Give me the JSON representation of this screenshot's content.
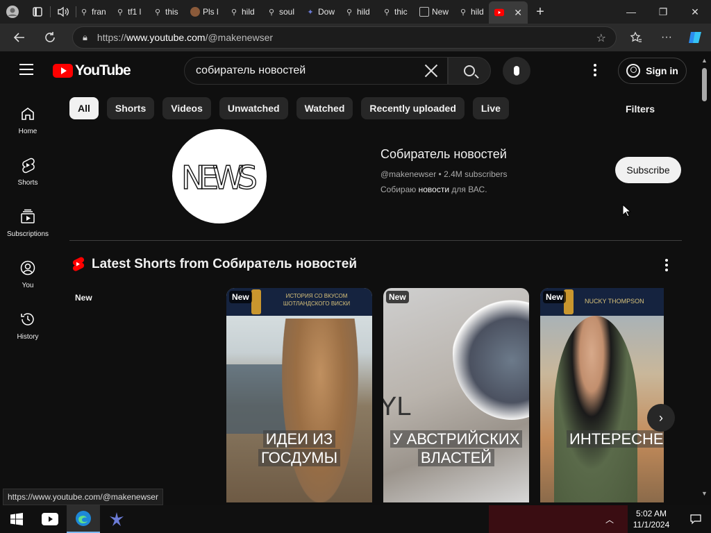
{
  "browser": {
    "tabs": [
      {
        "label": "fran",
        "icon": "search-icon"
      },
      {
        "label": "tf1 l",
        "icon": "search-icon"
      },
      {
        "label": "this",
        "icon": "search-icon"
      },
      {
        "label": "Pls l",
        "icon": "avatar-icon"
      },
      {
        "label": "hild",
        "icon": "search-icon"
      },
      {
        "label": "soul",
        "icon": "search-icon"
      },
      {
        "label": "Dow",
        "icon": "dove-icon"
      },
      {
        "label": "hild",
        "icon": "search-icon"
      },
      {
        "label": "thic",
        "icon": "search-icon"
      },
      {
        "label": "New",
        "icon": "page-icon"
      },
      {
        "label": "hild",
        "icon": "search-icon"
      }
    ],
    "url_prefix": "https://",
    "url_host": "www.youtube.com",
    "url_path": "/@makenewser",
    "status_url": "https://www.youtube.com/@makenewser"
  },
  "youtube": {
    "logo_text": "YouTube",
    "search_value": "собиратель новостей",
    "signin_label": "Sign in",
    "sidebar": [
      {
        "label": "Home",
        "icon": "home-icon"
      },
      {
        "label": "Shorts",
        "icon": "shorts-icon"
      },
      {
        "label": "Subscriptions",
        "icon": "subscriptions-icon"
      },
      {
        "label": "You",
        "icon": "you-icon"
      },
      {
        "label": "History",
        "icon": "history-icon"
      }
    ],
    "chips": [
      "All",
      "Shorts",
      "Videos",
      "Unwatched",
      "Watched",
      "Recently uploaded",
      "Live"
    ],
    "filters_label": "Filters",
    "channel": {
      "avatar_text": "NEWS",
      "name": "Собиратель новостей",
      "handle": "@makenewser",
      "subscribers": "2.4M subscribers",
      "desc_pre": "Собираю ",
      "desc_bold": "новости",
      "desc_post": " для ВАС.",
      "subscribe_label": "Subscribe"
    },
    "shorts_section": {
      "title": "Latest Shorts from Собиратель новостей",
      "new_label": "New",
      "cards": [
        {
          "badge": "New",
          "banner": "ИСТОРИЯ СО ВКУСОМ ШОТЛАНДСКОГО ВИСКИ",
          "caption_line1": "ИДЕИ ИЗ",
          "caption_line2": "ГОСДУМЫ"
        },
        {
          "badge": "New",
          "banner": "",
          "caption_line1": "У АВСТРИЙСКИХ",
          "caption_line2": "ВЛАСТЕЙ"
        },
        {
          "badge": "New",
          "banner": "NUCKY THOMPSON",
          "caption_line1": "ИНТЕРЕСНЕЕ",
          "caption_line2": ""
        }
      ]
    }
  },
  "taskbar": {
    "time": "5:02 AM",
    "date": "11/1/2024"
  },
  "colors": {
    "brand_red": "#ff0000",
    "bg": "#0f0f0f",
    "chip": "#272727"
  }
}
